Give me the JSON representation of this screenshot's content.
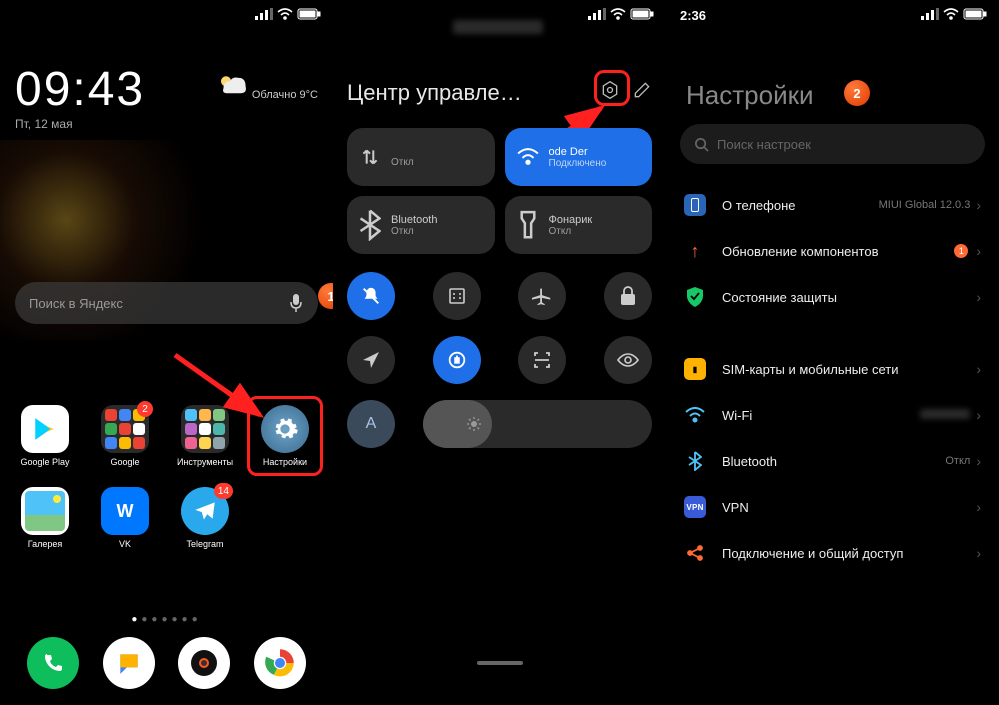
{
  "panel1": {
    "time": "09:43",
    "date": "Пт, 12 мая",
    "weather_cond": "Облачно",
    "weather_temp": "9°C",
    "search_placeholder": "Поиск в Яндекс",
    "badge1": "1",
    "apps": {
      "googleplay": "Google Play",
      "google": "Google",
      "tools": "Инструменты",
      "settings": "Настройки",
      "gallery": "Галерея",
      "vk": "VK",
      "telegram": "Telegram",
      "google_badge": "2",
      "telegram_badge": "14"
    }
  },
  "panel2": {
    "title": "Центр управле…",
    "tiles": {
      "data_status": "Откл",
      "wifi_name": "ode   Der",
      "wifi_status": "Подключено",
      "bt": "Bluetooth",
      "bt_status": "Откл",
      "flash": "Фонарик",
      "flash_status": "Откл"
    },
    "auto_label": "A"
  },
  "panel3": {
    "time": "2:36",
    "title": "Настройки",
    "badge2": "2",
    "search_placeholder": "Поиск настроек",
    "rows": {
      "about": "О телефоне",
      "about_val": "MIUI Global 12.0.3",
      "update": "Обновление компонентов",
      "update_badge": "1",
      "security": "Состояние защиты",
      "sim": "SIM-карты и мобильные сети",
      "wifi": "Wi-Fi",
      "bt": "Bluetooth",
      "bt_val": "Откл",
      "vpn": "VPN",
      "share": "Подключение и общий доступ"
    }
  }
}
